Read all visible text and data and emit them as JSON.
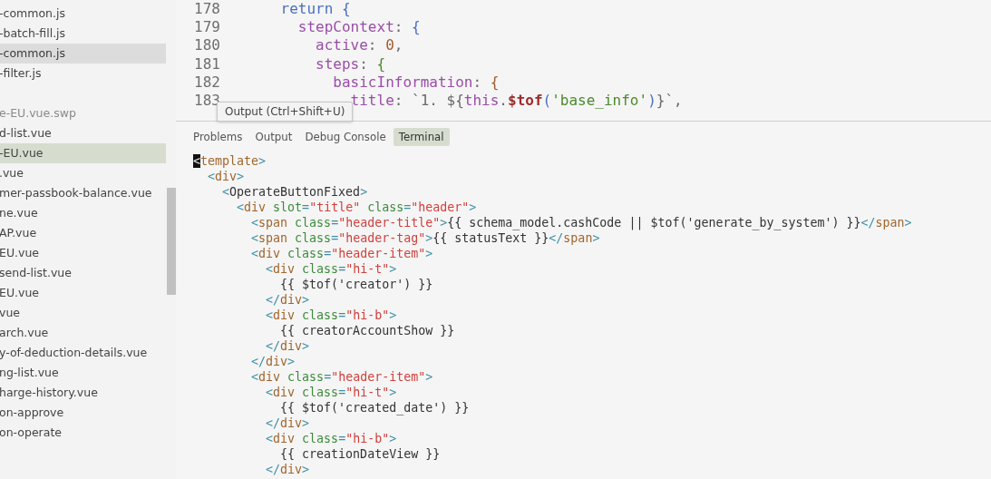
{
  "sidebar": {
    "groups": [
      [
        {
          "name": "-common.js",
          "selected": false,
          "hovered": false,
          "dimmed": false
        },
        {
          "name": "-batch-fill.js",
          "selected": false,
          "hovered": false,
          "dimmed": false
        },
        {
          "name": "-common.js",
          "selected": false,
          "hovered": true,
          "dimmed": false
        },
        {
          "name": "-filter.js",
          "selected": false,
          "hovered": false,
          "dimmed": false
        }
      ],
      [
        {
          "name": "e-EU.vue.swp",
          "selected": false,
          "hovered": false,
          "dimmed": true
        },
        {
          "name": "d-list.vue",
          "selected": false,
          "hovered": false,
          "dimmed": false
        },
        {
          "name": "-EU.vue",
          "selected": true,
          "hovered": false,
          "dimmed": false
        },
        {
          "name": ".vue",
          "selected": false,
          "hovered": false,
          "dimmed": false
        },
        {
          "name": "mer-passbook-balance.vue",
          "selected": false,
          "hovered": false,
          "dimmed": false
        },
        {
          "name": "ne.vue",
          "selected": false,
          "hovered": false,
          "dimmed": false
        },
        {
          "name": "AP.vue",
          "selected": false,
          "hovered": false,
          "dimmed": false
        },
        {
          "name": "EU.vue",
          "selected": false,
          "hovered": false,
          "dimmed": false
        },
        {
          "name": "send-list.vue",
          "selected": false,
          "hovered": false,
          "dimmed": false
        },
        {
          "name": "EU.vue",
          "selected": false,
          "hovered": false,
          "dimmed": false
        },
        {
          "name": "vue",
          "selected": false,
          "hovered": false,
          "dimmed": false
        },
        {
          "name": "arch.vue",
          "selected": false,
          "hovered": false,
          "dimmed": false
        },
        {
          "name": "y-of-deduction-details.vue",
          "selected": false,
          "hovered": false,
          "dimmed": false
        },
        {
          "name": "ng-list.vue",
          "selected": false,
          "hovered": false,
          "dimmed": false
        },
        {
          "name": "harge-history.vue",
          "selected": false,
          "hovered": false,
          "dimmed": false
        },
        {
          "name": "on-approve",
          "selected": false,
          "hovered": false,
          "dimmed": false
        },
        {
          "name": "on-operate",
          "selected": false,
          "hovered": false,
          "dimmed": false
        }
      ]
    ]
  },
  "editor": {
    "lines": [
      {
        "number": "178",
        "tokens": [
          {
            "text": "    return",
            "kind": "keyword"
          },
          {
            "text": " {",
            "kind": "keyword"
          }
        ]
      },
      {
        "number": "179",
        "tokens": [
          {
            "text": "      stepContext",
            "kind": "prop"
          },
          {
            "text": ": ",
            "kind": "plain"
          },
          {
            "text": "{",
            "kind": "keyword"
          }
        ]
      },
      {
        "number": "180",
        "tokens": [
          {
            "text": "        active",
            "kind": "prop"
          },
          {
            "text": ": ",
            "kind": "plain"
          },
          {
            "text": "0",
            "kind": "number"
          },
          {
            "text": ",",
            "kind": "plain"
          }
        ]
      },
      {
        "number": "181",
        "tokens": [
          {
            "text": "        steps",
            "kind": "prop"
          },
          {
            "text": ": ",
            "kind": "plain"
          },
          {
            "text": "{",
            "kind": "string"
          }
        ]
      },
      {
        "number": "182",
        "tokens": [
          {
            "text": "          basicInformation",
            "kind": "prop"
          },
          {
            "text": ": ",
            "kind": "plain"
          },
          {
            "text": "{",
            "kind": "number"
          }
        ]
      },
      {
        "number": "183",
        "tokens": [
          {
            "text": "            title",
            "kind": "prop"
          },
          {
            "text": ": `1. ${",
            "kind": "plain"
          },
          {
            "text": "this",
            "kind": "prop"
          },
          {
            "text": ".",
            "kind": "plain"
          },
          {
            "text": "$tof",
            "kind": "func"
          },
          {
            "text": "(",
            "kind": "keyword"
          },
          {
            "text": "'base_info'",
            "kind": "string"
          },
          {
            "text": ")",
            "kind": "keyword"
          },
          {
            "text": "}`,",
            "kind": "plain"
          }
        ]
      }
    ]
  },
  "tooltip": "Output (Ctrl+Shift+U)",
  "panel": {
    "tabs": [
      {
        "label": "Problems",
        "selected": false
      },
      {
        "label": "Output",
        "selected": false
      },
      {
        "label": "Debug Console",
        "selected": false
      },
      {
        "label": "Terminal",
        "selected": true
      }
    ],
    "terminal": [
      [
        {
          "text": "<",
          "kind": "cursor"
        },
        {
          "text": "template",
          "kind": "tag"
        },
        {
          "text": ">",
          "kind": "punct"
        }
      ],
      [
        {
          "text": "  <",
          "kind": "punct"
        },
        {
          "text": "div",
          "kind": "tag"
        },
        {
          "text": ">",
          "kind": "punct"
        }
      ],
      [
        {
          "text": "    <",
          "kind": "punct"
        },
        {
          "text": "OperateButtonFixed",
          "kind": "text"
        },
        {
          "text": ">",
          "kind": "punct"
        }
      ],
      [
        {
          "text": "      <",
          "kind": "punct"
        },
        {
          "text": "div",
          "kind": "tag"
        },
        {
          "text": " slot",
          "kind": "attr"
        },
        {
          "text": "=",
          "kind": "punct"
        },
        {
          "text": "\"title\"",
          "kind": "str"
        },
        {
          "text": " class",
          "kind": "attr"
        },
        {
          "text": "=",
          "kind": "punct"
        },
        {
          "text": "\"header\"",
          "kind": "str"
        },
        {
          "text": ">",
          "kind": "punct"
        }
      ],
      [
        {
          "text": "        <",
          "kind": "punct"
        },
        {
          "text": "span",
          "kind": "tag"
        },
        {
          "text": " class",
          "kind": "attr"
        },
        {
          "text": "=",
          "kind": "punct"
        },
        {
          "text": "\"header-title\"",
          "kind": "str"
        },
        {
          "text": ">",
          "kind": "punct"
        },
        {
          "text": "{{ schema_model.cashCode || $tof('generate_by_system') }}",
          "kind": "text"
        },
        {
          "text": "</",
          "kind": "punct"
        },
        {
          "text": "span",
          "kind": "tag"
        },
        {
          "text": ">",
          "kind": "punct"
        }
      ],
      [
        {
          "text": "        <",
          "kind": "punct"
        },
        {
          "text": "span",
          "kind": "tag"
        },
        {
          "text": " class",
          "kind": "attr"
        },
        {
          "text": "=",
          "kind": "punct"
        },
        {
          "text": "\"header-tag\"",
          "kind": "str"
        },
        {
          "text": ">",
          "kind": "punct"
        },
        {
          "text": "{{ statusText }}",
          "kind": "text"
        },
        {
          "text": "</",
          "kind": "punct"
        },
        {
          "text": "span",
          "kind": "tag"
        },
        {
          "text": ">",
          "kind": "punct"
        }
      ],
      [
        {
          "text": "        <",
          "kind": "punct"
        },
        {
          "text": "div",
          "kind": "tag"
        },
        {
          "text": " class",
          "kind": "attr"
        },
        {
          "text": "=",
          "kind": "punct"
        },
        {
          "text": "\"header-item\"",
          "kind": "str"
        },
        {
          "text": ">",
          "kind": "punct"
        }
      ],
      [
        {
          "text": "          <",
          "kind": "punct"
        },
        {
          "text": "div",
          "kind": "tag"
        },
        {
          "text": " class",
          "kind": "attr"
        },
        {
          "text": "=",
          "kind": "punct"
        },
        {
          "text": "\"hi-t\"",
          "kind": "str"
        },
        {
          "text": ">",
          "kind": "punct"
        }
      ],
      [
        {
          "text": "            {{ $tof('creator') }}",
          "kind": "text"
        }
      ],
      [
        {
          "text": "          </",
          "kind": "punct"
        },
        {
          "text": "div",
          "kind": "tag"
        },
        {
          "text": ">",
          "kind": "punct"
        }
      ],
      [
        {
          "text": "          <",
          "kind": "punct"
        },
        {
          "text": "div",
          "kind": "tag"
        },
        {
          "text": " class",
          "kind": "attr"
        },
        {
          "text": "=",
          "kind": "punct"
        },
        {
          "text": "\"hi-b\"",
          "kind": "str"
        },
        {
          "text": ">",
          "kind": "punct"
        }
      ],
      [
        {
          "text": "            {{ creatorAccountShow }}",
          "kind": "text"
        }
      ],
      [
        {
          "text": "          </",
          "kind": "punct"
        },
        {
          "text": "div",
          "kind": "tag"
        },
        {
          "text": ">",
          "kind": "punct"
        }
      ],
      [
        {
          "text": "        </",
          "kind": "punct"
        },
        {
          "text": "div",
          "kind": "tag"
        },
        {
          "text": ">",
          "kind": "punct"
        }
      ],
      [
        {
          "text": "        <",
          "kind": "punct"
        },
        {
          "text": "div",
          "kind": "tag"
        },
        {
          "text": " class",
          "kind": "attr"
        },
        {
          "text": "=",
          "kind": "punct"
        },
        {
          "text": "\"header-item\"",
          "kind": "str"
        },
        {
          "text": ">",
          "kind": "punct"
        }
      ],
      [
        {
          "text": "          <",
          "kind": "punct"
        },
        {
          "text": "div",
          "kind": "tag"
        },
        {
          "text": " class",
          "kind": "attr"
        },
        {
          "text": "=",
          "kind": "punct"
        },
        {
          "text": "\"hi-t\"",
          "kind": "str"
        },
        {
          "text": ">",
          "kind": "punct"
        }
      ],
      [
        {
          "text": "            {{ $tof('created_date') }}",
          "kind": "text"
        }
      ],
      [
        {
          "text": "          </",
          "kind": "punct"
        },
        {
          "text": "div",
          "kind": "tag"
        },
        {
          "text": ">",
          "kind": "punct"
        }
      ],
      [
        {
          "text": "          <",
          "kind": "punct"
        },
        {
          "text": "div",
          "kind": "tag"
        },
        {
          "text": " class",
          "kind": "attr"
        },
        {
          "text": "=",
          "kind": "punct"
        },
        {
          "text": "\"hi-b\"",
          "kind": "str"
        },
        {
          "text": ">",
          "kind": "punct"
        }
      ],
      [
        {
          "text": "            {{ creationDateView }}",
          "kind": "text"
        }
      ],
      [
        {
          "text": "          </",
          "kind": "punct"
        },
        {
          "text": "div",
          "kind": "tag"
        },
        {
          "text": ">",
          "kind": "punct"
        }
      ]
    ]
  }
}
